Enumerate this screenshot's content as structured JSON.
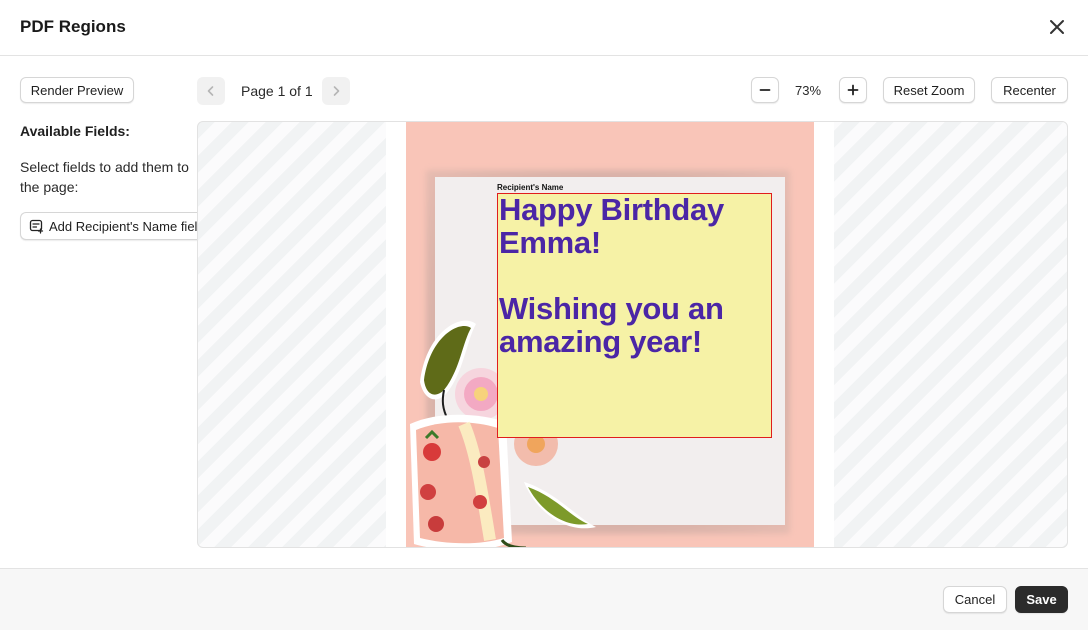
{
  "dialog": {
    "title": "PDF Regions"
  },
  "toolbar": {
    "render_preview_label": "Render Preview",
    "page_indicator": "Page 1 of 1",
    "zoom_level": "73%",
    "reset_zoom_label": "Reset Zoom",
    "recenter_label": "Recenter",
    "icons": {
      "prev": "chevron-left-icon",
      "next": "chevron-right-icon",
      "zoom_out": "minus-icon",
      "zoom_in": "plus-icon",
      "close": "close-icon"
    }
  },
  "sidebar": {
    "heading": "Available Fields:",
    "description": "Select fields to add them to the page:",
    "add_field_label": "Add Recipient's Name field",
    "add_field_icon": "add-text-field-icon"
  },
  "preview": {
    "field_label": "Recipient's Name",
    "field_text": "Happy Birthday\nEmma!\n\nWishing you an\namazing year!",
    "colors": {
      "page_background": "#f9c5b8",
      "field_fill": "#f6f2a6",
      "field_border": "#e01d1d",
      "field_text": "#4b26a6"
    }
  },
  "footer": {
    "cancel_label": "Cancel",
    "save_label": "Save"
  }
}
